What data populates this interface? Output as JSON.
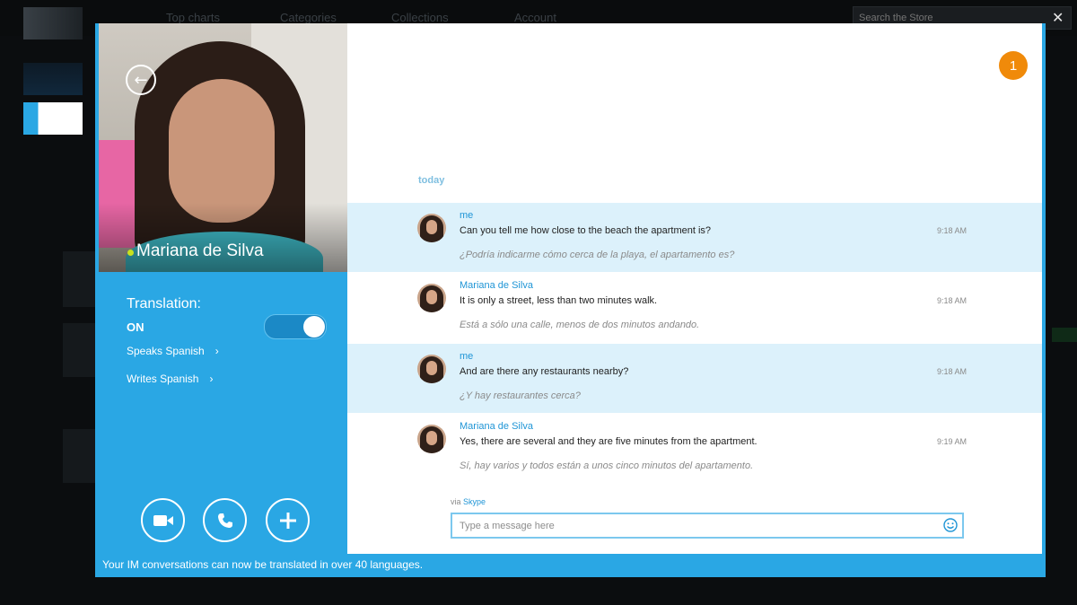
{
  "background": {
    "nav_items": [
      "Top charts",
      "Categories",
      "Collections",
      "Account"
    ],
    "search_placeholder": "Search the Store",
    "close_glyph": "✕"
  },
  "modal": {
    "back_glyph": "←",
    "contact": {
      "name": "Mariana de Silva",
      "status_color": "#c8e11e"
    },
    "translation": {
      "label": "Translation:",
      "state": "ON",
      "speaks": "Speaks Spanish",
      "writes": "Writes Spanish",
      "chevron": "›"
    },
    "actions": [
      {
        "icon": "video-call-icon"
      },
      {
        "icon": "phone-call-icon"
      },
      {
        "icon": "add-icon"
      }
    ],
    "notification_count": "1",
    "day_label": "today",
    "messages": [
      {
        "sender": "me",
        "text": "Can you tell me how close to the beach the apartment is?",
        "time": "9:18 AM",
        "translation": "¿Podría indicarme cómo cerca de la playa, el apartamento es?"
      },
      {
        "sender": "Mariana de Silva",
        "text": "It is only a street, less than two minutes walk.",
        "time": "9:18 AM",
        "translation": "Está a sólo una calle, menos de dos minutos andando."
      },
      {
        "sender": "me",
        "text": "And are there any restaurants nearby?",
        "time": "9:18 AM",
        "translation": "¿Y hay restaurantes cerca?"
      },
      {
        "sender": "Mariana de Silva",
        "text": "Yes, there are several and they are five minutes from the apartment.",
        "time": "9:19 AM",
        "translation": "Sí, hay varios y todos están a unos cinco minutos del apartamento."
      }
    ],
    "via_prefix": "via",
    "via_brand": "Skype",
    "input_placeholder": "Type a message here",
    "footer": "Your IM conversations can now be translated in over 40 languages."
  },
  "colors": {
    "accent": "#2aa7e4",
    "mine_bubble": "#dcf1fb",
    "notification": "#f08a0a"
  }
}
